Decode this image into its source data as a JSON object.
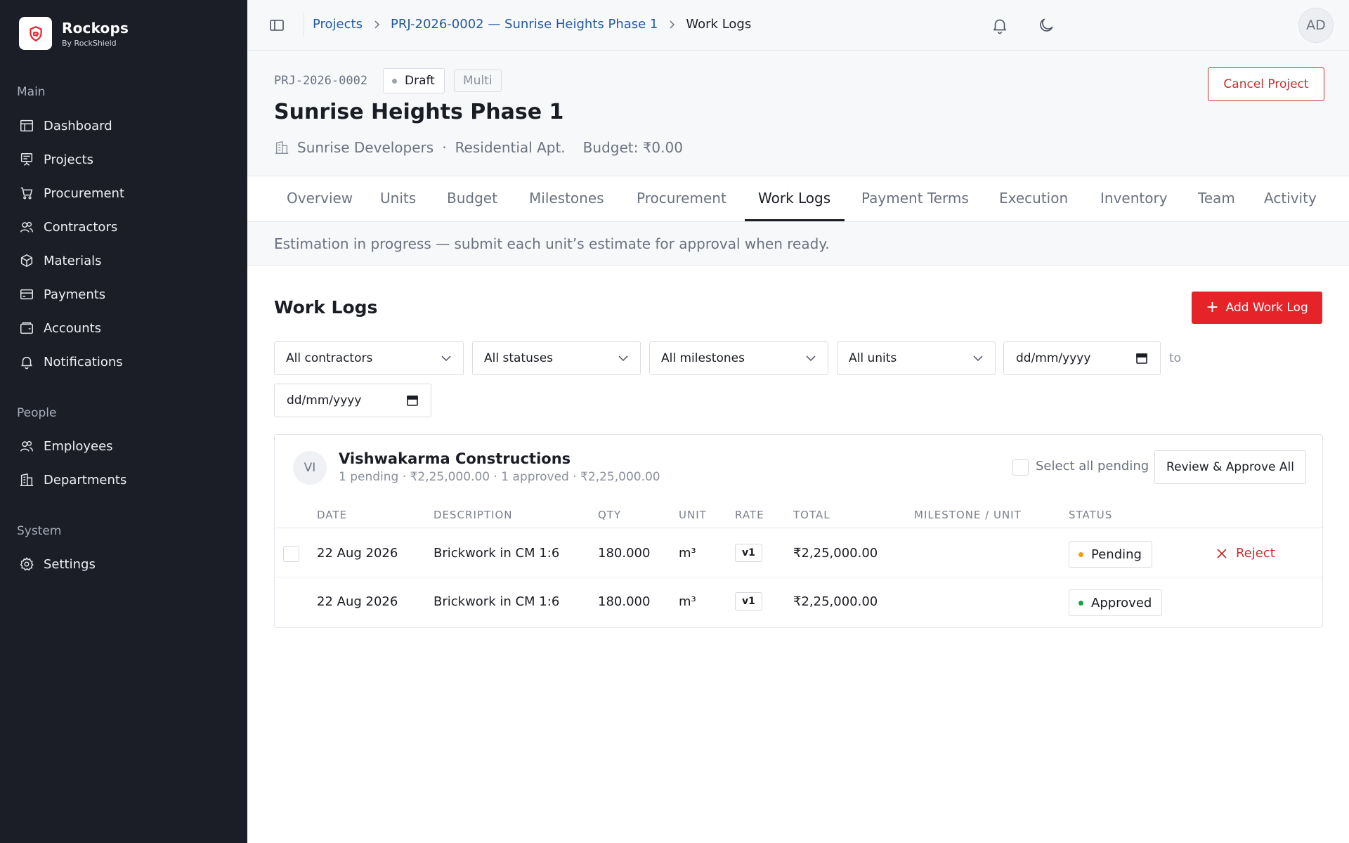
{
  "brand": {
    "name": "Rockops",
    "sub": "By RockShield",
    "accent": "#e52329"
  },
  "sidebar": {
    "sections": [
      {
        "label": "Main",
        "items": [
          {
            "label": "Dashboard",
            "icon": "dashboard-icon"
          },
          {
            "label": "Projects",
            "icon": "projects-icon"
          },
          {
            "label": "Procurement",
            "icon": "cart-icon"
          },
          {
            "label": "Contractors",
            "icon": "users-icon"
          },
          {
            "label": "Materials",
            "icon": "box-icon"
          },
          {
            "label": "Payments",
            "icon": "card-icon"
          },
          {
            "label": "Accounts",
            "icon": "wallet-icon"
          },
          {
            "label": "Notifications",
            "icon": "bell-icon"
          }
        ]
      },
      {
        "label": "People",
        "items": [
          {
            "label": "Employees",
            "icon": "users-icon"
          },
          {
            "label": "Departments",
            "icon": "building-icon"
          }
        ]
      },
      {
        "label": "System",
        "items": [
          {
            "label": "Settings",
            "icon": "gear-icon"
          }
        ]
      }
    ]
  },
  "topbar": {
    "breadcrumbs": [
      "Projects",
      "PRJ-2026-0002 — Sunrise Heights Phase 1",
      "Work Logs"
    ],
    "avatar": "AD"
  },
  "project": {
    "code": "PRJ-2026-0002",
    "status": "Draft",
    "type_badge": "Multi",
    "title": "Sunrise Heights Phase 1",
    "client": "Sunrise Developers",
    "category": "Residential Apt.",
    "separator": "·",
    "budget": "Budget: ₹0.00",
    "cancel_label": "Cancel Project"
  },
  "tabs": [
    {
      "label": "Overview",
      "active": false
    },
    {
      "label": "Units",
      "active": false
    },
    {
      "label": "Budget",
      "active": false
    },
    {
      "label": "Milestones",
      "active": false
    },
    {
      "label": "Procurement",
      "active": false
    },
    {
      "label": "Work Logs",
      "active": true
    },
    {
      "label": "Payment Terms",
      "active": false
    },
    {
      "label": "Execution",
      "active": false
    },
    {
      "label": "Inventory",
      "active": false
    },
    {
      "label": "Team",
      "active": false
    },
    {
      "label": "Activity",
      "active": false
    }
  ],
  "notice": "Estimation in progress — submit each unit’s estimate for approval when ready.",
  "worklogs": {
    "title": "Work Logs",
    "add_label": "Add Work Log",
    "filters": {
      "contractor": "All contractors",
      "status": "All statuses",
      "milestone": "All milestones",
      "unit": "All units",
      "date_from_placeholder": "dd/mm/yyyy",
      "to_label": "to",
      "date_to_placeholder": "dd/mm/yyyy"
    },
    "group": {
      "initials": "VI",
      "name": "Vishwakarma Constructions",
      "summary": "1 pending · ₹2,25,000.00 · 1 approved · ₹2,25,000.00",
      "select_all_label": "Select all pending",
      "review_label": "Review & Approve All"
    },
    "columns": [
      "DATE",
      "DESCRIPTION",
      "QTY",
      "UNIT",
      "RATE",
      "TOTAL",
      "MILESTONE / UNIT",
      "STATUS"
    ],
    "rows": [
      {
        "date": "22 Aug 2026",
        "description": "Brickwork in CM 1:6",
        "qty": "180.000",
        "unit": "m³",
        "rate": "v1",
        "total": "₹2,25,000.00",
        "milestone": "",
        "status": "Pending",
        "status_color": "#f59e0b",
        "action": "Reject"
      },
      {
        "date": "22 Aug 2026",
        "description": "Brickwork in CM 1:6",
        "qty": "180.000",
        "unit": "m³",
        "rate": "v1",
        "total": "₹2,25,000.00",
        "milestone": "",
        "status": "Approved",
        "status_color": "#16a34a",
        "action": ""
      }
    ]
  },
  "colors": {
    "sidebar_bg": "#1b1e27",
    "link": "#235a9f",
    "danger": "#c53030",
    "draft_dot": "#9ca3af"
  }
}
